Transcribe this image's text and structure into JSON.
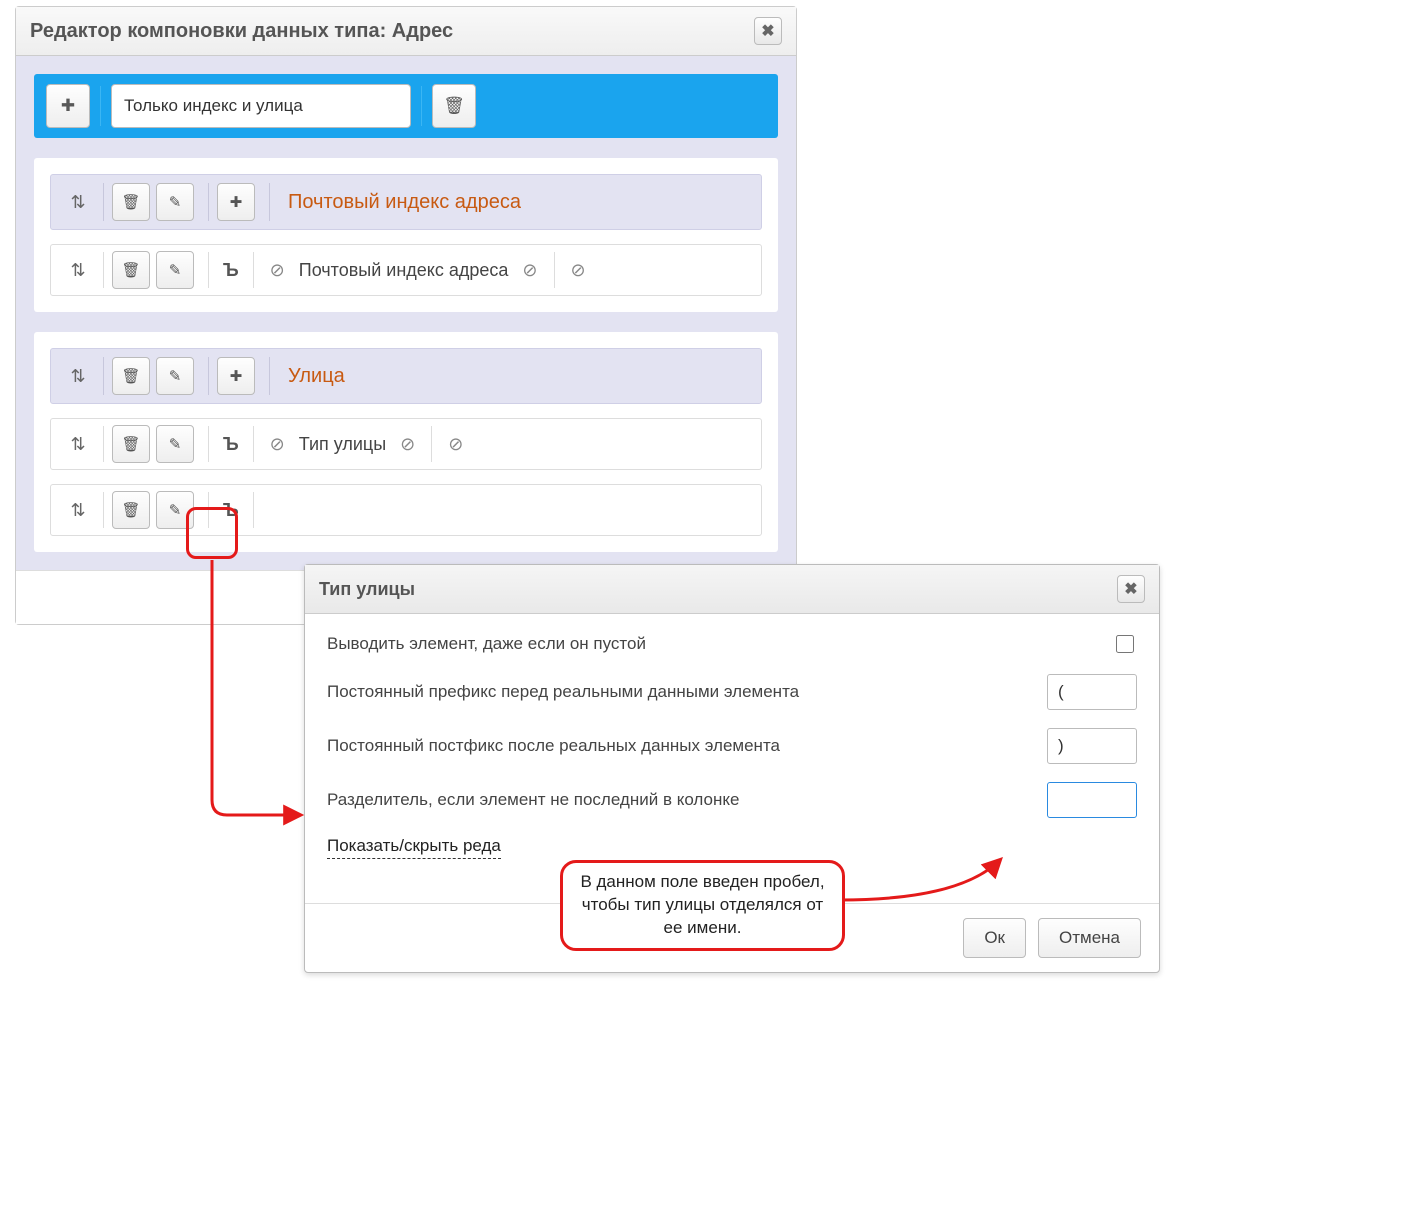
{
  "panel": {
    "title": "Редактор компоновки данных типа: Адрес",
    "layout_name": "Только индекс и улица"
  },
  "sections": [
    {
      "title": "Почтовый индекс адреса",
      "rows": [
        {
          "label": "Почтовый индекс адреса"
        }
      ]
    },
    {
      "title": "Улица",
      "rows": [
        {
          "label": "Тип улицы"
        },
        {
          "label": ""
        }
      ]
    }
  ],
  "dialog": {
    "title": "Тип улицы",
    "fields": {
      "output_if_empty_label": "Выводить элемент, даже если он пустой",
      "output_if_empty_value": false,
      "prefix_label": "Постоянный префикс перед реальными данными элемента",
      "prefix_value": "(",
      "postfix_label": "Постоянный постфикс после реальных данных элемента",
      "postfix_value": ")",
      "separator_label": "Разделитель, если элемент не последний в колонке",
      "separator_value": " "
    },
    "toggle_label": "Показать/скрыть реда",
    "ok": "Ок",
    "cancel": "Отмена"
  },
  "annotation": {
    "callout_text": "В данном поле введен пробел, чтобы тип улицы отделялся от ее имени."
  },
  "icons": {
    "plus": "✚",
    "trash": "🗑",
    "pencil": "✎",
    "updown": "⇅",
    "anchor": "Ъ",
    "noentry": "⊘",
    "close": "✖"
  }
}
